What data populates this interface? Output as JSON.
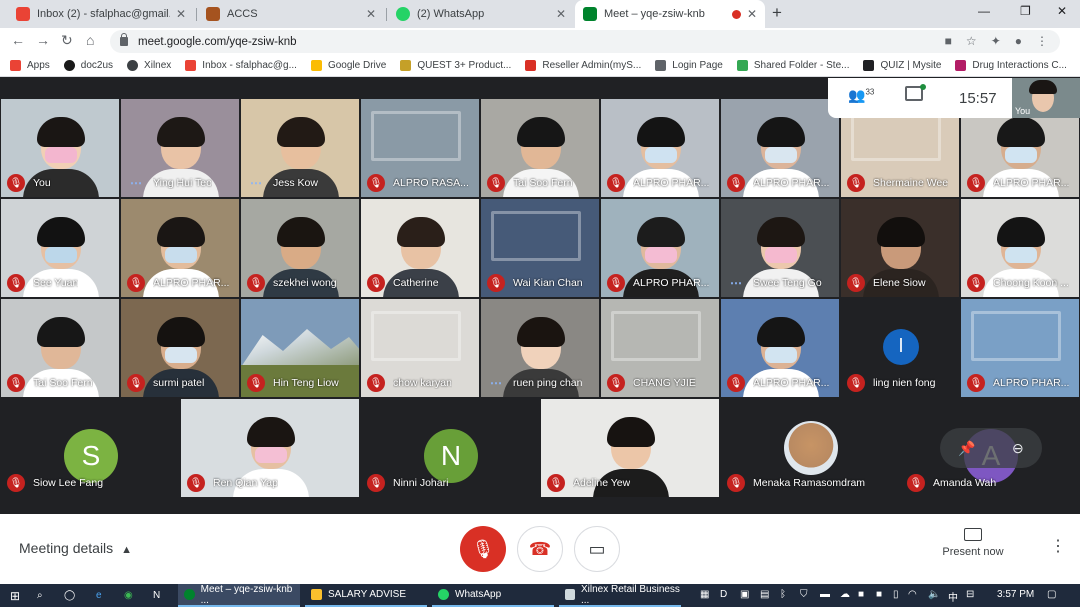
{
  "browser": {
    "tabs": [
      {
        "label": "Inbox (2) - sfalphac@gmail.com",
        "icon": "gmail-icon",
        "color": "#ea4335",
        "active": false
      },
      {
        "label": "ACCS",
        "icon": "accs-icon",
        "color": "#a5531f",
        "active": false
      },
      {
        "label": "(2) WhatsApp",
        "icon": "whatsapp-icon",
        "color": "#25d366",
        "active": false
      },
      {
        "label": "Meet – yqe-zsiw-knb",
        "icon": "meet-icon",
        "color": "#00832d",
        "active": true
      }
    ],
    "recording_dot_color": "#d93025",
    "new_tab": "+",
    "url": "meet.google.com/yqe-zsiw-knb",
    "bookmarks": [
      {
        "label": "Apps",
        "color": "#ea4335"
      },
      {
        "label": "doc2us",
        "color": "#1a1a1a"
      },
      {
        "label": "Xilnex",
        "color": "#3c4043"
      },
      {
        "label": "Inbox - sfalphac@g...",
        "color": "#ea4335"
      },
      {
        "label": "Google Drive",
        "color": "#fbbc04"
      },
      {
        "label": "QUEST 3+ Product...",
        "color": "#c5a028"
      },
      {
        "label": "Reseller Admin(myS...",
        "color": "#d93025"
      },
      {
        "label": "Login Page",
        "color": "#5f6368"
      },
      {
        "label": "Shared Folder - Ste...",
        "color": "#34a853"
      },
      {
        "label": "QUIZ | Mysite",
        "color": "#202124"
      },
      {
        "label": "Drug Interactions C...",
        "color": "#b31d66"
      }
    ]
  },
  "meet": {
    "participant_count": "33",
    "time": "15:57",
    "self_label": "You",
    "tiles": [
      {
        "name": "You",
        "mic": "off",
        "scene": "#bfc9cf",
        "skin": "#f1cfb5",
        "hair": "#1a1614",
        "mask": "#f3b6cf",
        "body": "#2b2b2b",
        "kind": "person"
      },
      {
        "name": "Ying Hui Teo",
        "mic": "talking",
        "scene": "#9a8f9b",
        "skin": "#e9c3a6",
        "hair": "#1d1815",
        "mask": "",
        "body": "#f0f0f0",
        "kind": "person"
      },
      {
        "name": "Jess Kow",
        "mic": "talking",
        "scene": "#d7c6a8",
        "skin": "#e7bf9e",
        "hair": "#221a15",
        "mask": "",
        "body": "#3a3a3a",
        "kind": "person"
      },
      {
        "name": "ALPRO RASA...",
        "mic": "off",
        "scene": "#8a9aa6",
        "skin": "",
        "hair": "",
        "mask": "",
        "body": "",
        "kind": "room"
      },
      {
        "name": "Tai Soo Fern",
        "mic": "off",
        "scene": "#a9a8a3",
        "skin": "#e1b796",
        "hair": "#161616",
        "mask": "",
        "body": "#f5f5f5",
        "kind": "person"
      },
      {
        "name": "ALPRO PHAR...",
        "mic": "off",
        "scene": "#b9bfc6",
        "skin": "#e4bea0",
        "hair": "#141414",
        "mask": "#cfe2f1",
        "body": "#ffffff",
        "kind": "person"
      },
      {
        "name": "ALPRO PHAR...",
        "mic": "off",
        "scene": "#9aa3ad",
        "skin": "#dcb49a",
        "hair": "#151515",
        "mask": "#d9e6f0",
        "body": "#ffffff",
        "kind": "person"
      },
      {
        "name": "Shermaine Wee",
        "mic": "off",
        "scene": "#d9cbb9",
        "skin": "",
        "hair": "",
        "mask": "",
        "body": "",
        "kind": "room"
      },
      {
        "name": "ALPRO PHAR...",
        "mic": "off",
        "scene": "#c9c7c2",
        "skin": "#d6ad8e",
        "hair": "#181818",
        "mask": "#d1e4f2",
        "body": "#ffffff",
        "kind": "person"
      },
      {
        "name": "See Yuan",
        "mic": "off",
        "scene": "#cfd3d6",
        "skin": "#e6c0a3",
        "hair": "#121212",
        "mask": "#bcd7ea",
        "body": "#ffffff",
        "kind": "person"
      },
      {
        "name": "ALPRO PHAR...",
        "mic": "off",
        "scene": "#9c8a6e",
        "skin": "#e3bc9c",
        "hair": "#1a1614",
        "mask": "#c8dded",
        "body": "#ffffff",
        "kind": "person"
      },
      {
        "name": "szekhei wong",
        "mic": "off",
        "scene": "#a6a8a2",
        "skin": "#d9ab86",
        "hair": "#1a1511",
        "mask": "",
        "body": "#2f3a44",
        "kind": "person"
      },
      {
        "name": "Catherine",
        "mic": "off",
        "scene": "#e7e5df",
        "skin": "#e8c2a4",
        "hair": "#2a1f19",
        "mask": "",
        "body": "#3b4048",
        "kind": "person"
      },
      {
        "name": "Wai Kian Chan",
        "mic": "off",
        "scene": "#465a78",
        "skin": "",
        "hair": "",
        "mask": "",
        "body": "",
        "kind": "room"
      },
      {
        "name": "ALPRO PHAR...",
        "mic": "off",
        "scene": "#9fb2bd",
        "skin": "#e0b99d",
        "hair": "#1c1c1c",
        "mask": "#f4bcd3",
        "body": "#1f1f1f",
        "kind": "person"
      },
      {
        "name": "Swee Teng Go",
        "mic": "talking",
        "scene": "#4b4f53",
        "skin": "#ecc8ad",
        "hair": "#1d1713",
        "mask": "#f5b9cf",
        "body": "#f1f1f1",
        "kind": "person"
      },
      {
        "name": "Elene Siow",
        "mic": "off",
        "scene": "#3a2f2a",
        "skin": "#c99a7a",
        "hair": "#120f0d",
        "mask": "",
        "body": "#2b2420",
        "kind": "person"
      },
      {
        "name": "Choong Koon ...",
        "mic": "off",
        "scene": "#dcdcda",
        "skin": "#dfb596",
        "hair": "#141414",
        "mask": "#cfe3f0",
        "body": "#ffffff",
        "kind": "person"
      },
      {
        "name": "Tai Soo Fern",
        "mic": "off",
        "scene": "#c5c8c9",
        "skin": "#e0b798",
        "hair": "#171717",
        "mask": "",
        "body": "#ffffff",
        "kind": "person"
      },
      {
        "name": "surmi patel",
        "mic": "off",
        "scene": "#7c6850",
        "skin": "#d8ad8c",
        "hair": "#151210",
        "mask": "#d7e5f0",
        "body": "#27303a",
        "kind": "person"
      },
      {
        "name": "Hin Teng Liow",
        "mic": "off",
        "scene": "#7e9bb9",
        "skin": "",
        "hair": "",
        "mask": "",
        "body": "",
        "kind": "landscape"
      },
      {
        "name": "chow karyan",
        "mic": "off",
        "scene": "#dcdad6",
        "skin": "",
        "hair": "",
        "mask": "",
        "body": "",
        "kind": "room"
      },
      {
        "name": "ruen ping chan",
        "mic": "talking",
        "scene": "#8a8884",
        "skin": "#f0d2bb",
        "hair": "#1a1410",
        "mask": "",
        "body": "#3a3a3a",
        "kind": "person"
      },
      {
        "name": "CHANG YJIE",
        "mic": "off",
        "scene": "#b6b7b3",
        "skin": "",
        "hair": "",
        "mask": "",
        "body": "",
        "kind": "room"
      },
      {
        "name": "ALPRO PHAR...",
        "mic": "off",
        "scene": "#5d7fb0",
        "skin": "#dcb294",
        "hair": "#151515",
        "mask": "#d2e4f1",
        "body": "#ffffff",
        "kind": "person"
      },
      {
        "name": "ling nien fong",
        "mic": "off",
        "scene": "#202124",
        "avatar": "l",
        "avatar_color": "#1565c0",
        "kind": "avatar-small"
      },
      {
        "name": "ALPRO PHAR...",
        "mic": "off",
        "scene": "#7aa0c6",
        "skin": "",
        "hair": "",
        "mask": "",
        "body": "",
        "kind": "room"
      },
      {
        "name": "Siow Lee Fang",
        "mic": "off",
        "scene": "#202124",
        "avatar": "S",
        "avatar_color": "#7cb342",
        "kind": "avatar"
      },
      {
        "name": "Ren Qian Yap",
        "mic": "off",
        "scene": "#d8dde0",
        "skin": "#e6c0a2",
        "hair": "#1a1512",
        "mask": "#f4bfd4",
        "body": "#ffffff",
        "kind": "person"
      },
      {
        "name": "Ninni Johari",
        "mic": "off",
        "scene": "#202124",
        "avatar": "N",
        "avatar_color": "#689f38",
        "kind": "avatar"
      },
      {
        "name": "Adeline Yew",
        "mic": "off",
        "scene": "#e9e9e7",
        "skin": "#ecc6a8",
        "hair": "#171311",
        "mask": "",
        "body": "#1c1c1c",
        "kind": "person"
      },
      {
        "name": "Menaka Ramasomdram",
        "mic": "off",
        "scene": "#202124",
        "avatar": "temple",
        "avatar_color": "#b98a62",
        "kind": "avatar-photo"
      },
      {
        "name": "Amanda Wah",
        "mic": "off",
        "scene": "#202124",
        "avatar": "A",
        "avatar_color": "#7e57c2",
        "kind": "avatar"
      }
    ],
    "controls": {
      "meeting_details": "Meeting details",
      "present_now": "Present now"
    }
  },
  "taskbar": {
    "apps": [
      {
        "label": "Meet – yqe-zsiw-knb ...",
        "color": "#00832d",
        "active": true
      },
      {
        "label": "SALARY ADVISE",
        "color": "#fbc02d",
        "active": false
      },
      {
        "label": "WhatsApp",
        "color": "#25d366",
        "active": false
      },
      {
        "label": "Xilnex Retail Business ...",
        "color": "#cfd8dc",
        "active": false
      }
    ],
    "ime": "中",
    "time": "3:57 PM"
  }
}
